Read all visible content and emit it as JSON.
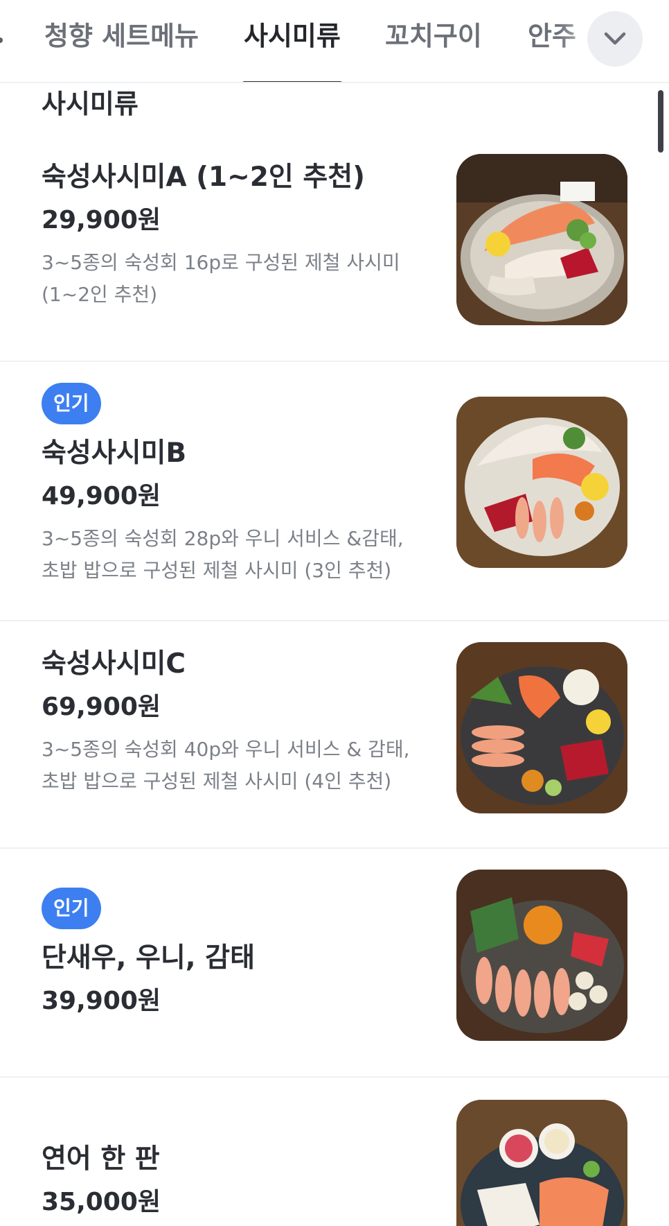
{
  "tabs": [
    {
      "label": "청향 세트메뉴",
      "active": false
    },
    {
      "label": "사시미류",
      "active": true
    },
    {
      "label": "꼬치구이",
      "active": false
    },
    {
      "label": "안주",
      "active": false
    }
  ],
  "more_icon": "chevron-down-icon",
  "section": {
    "title": "사시미류"
  },
  "colors": {
    "badge": "#3d7ff0",
    "text": "#2a2d33",
    "muted": "#7b8088"
  },
  "items": [
    {
      "name": "숙성사시미A (1~2인 추천)",
      "price": "29,900원",
      "desc_line1": "3~5종의 숙성회 16p로 구성된 제철 사시미",
      "desc_line2": "(1~2인 추천)",
      "badge": "",
      "image": "sashimi-platter-photo"
    },
    {
      "name": "숙성사시미B",
      "price": "49,900원",
      "desc_line1": "3~5종의 숙성회 28p와 우니 서비스 &감태,",
      "desc_line2": "초밥 밥으로 구성된 제철 사시미 (3인 추천)",
      "badge": "인기",
      "image": "sashimi-platter-photo"
    },
    {
      "name": "숙성사시미C",
      "price": "69,900원",
      "desc_line1": "3~5종의 숙성회 40p와 우니 서비스 & 감태,",
      "desc_line2": "초밥 밥으로 구성된 제철 사시미 (4인 추천)",
      "badge": "",
      "image": "sashimi-platter-photo"
    },
    {
      "name": "단새우, 우니, 감태",
      "price": "39,900원",
      "badge": "인기",
      "image": "shrimp-uni-platter-photo"
    },
    {
      "name": "연어 한 판",
      "price": "35,000원",
      "badge": "",
      "image": "salmon-platter-photo"
    }
  ]
}
